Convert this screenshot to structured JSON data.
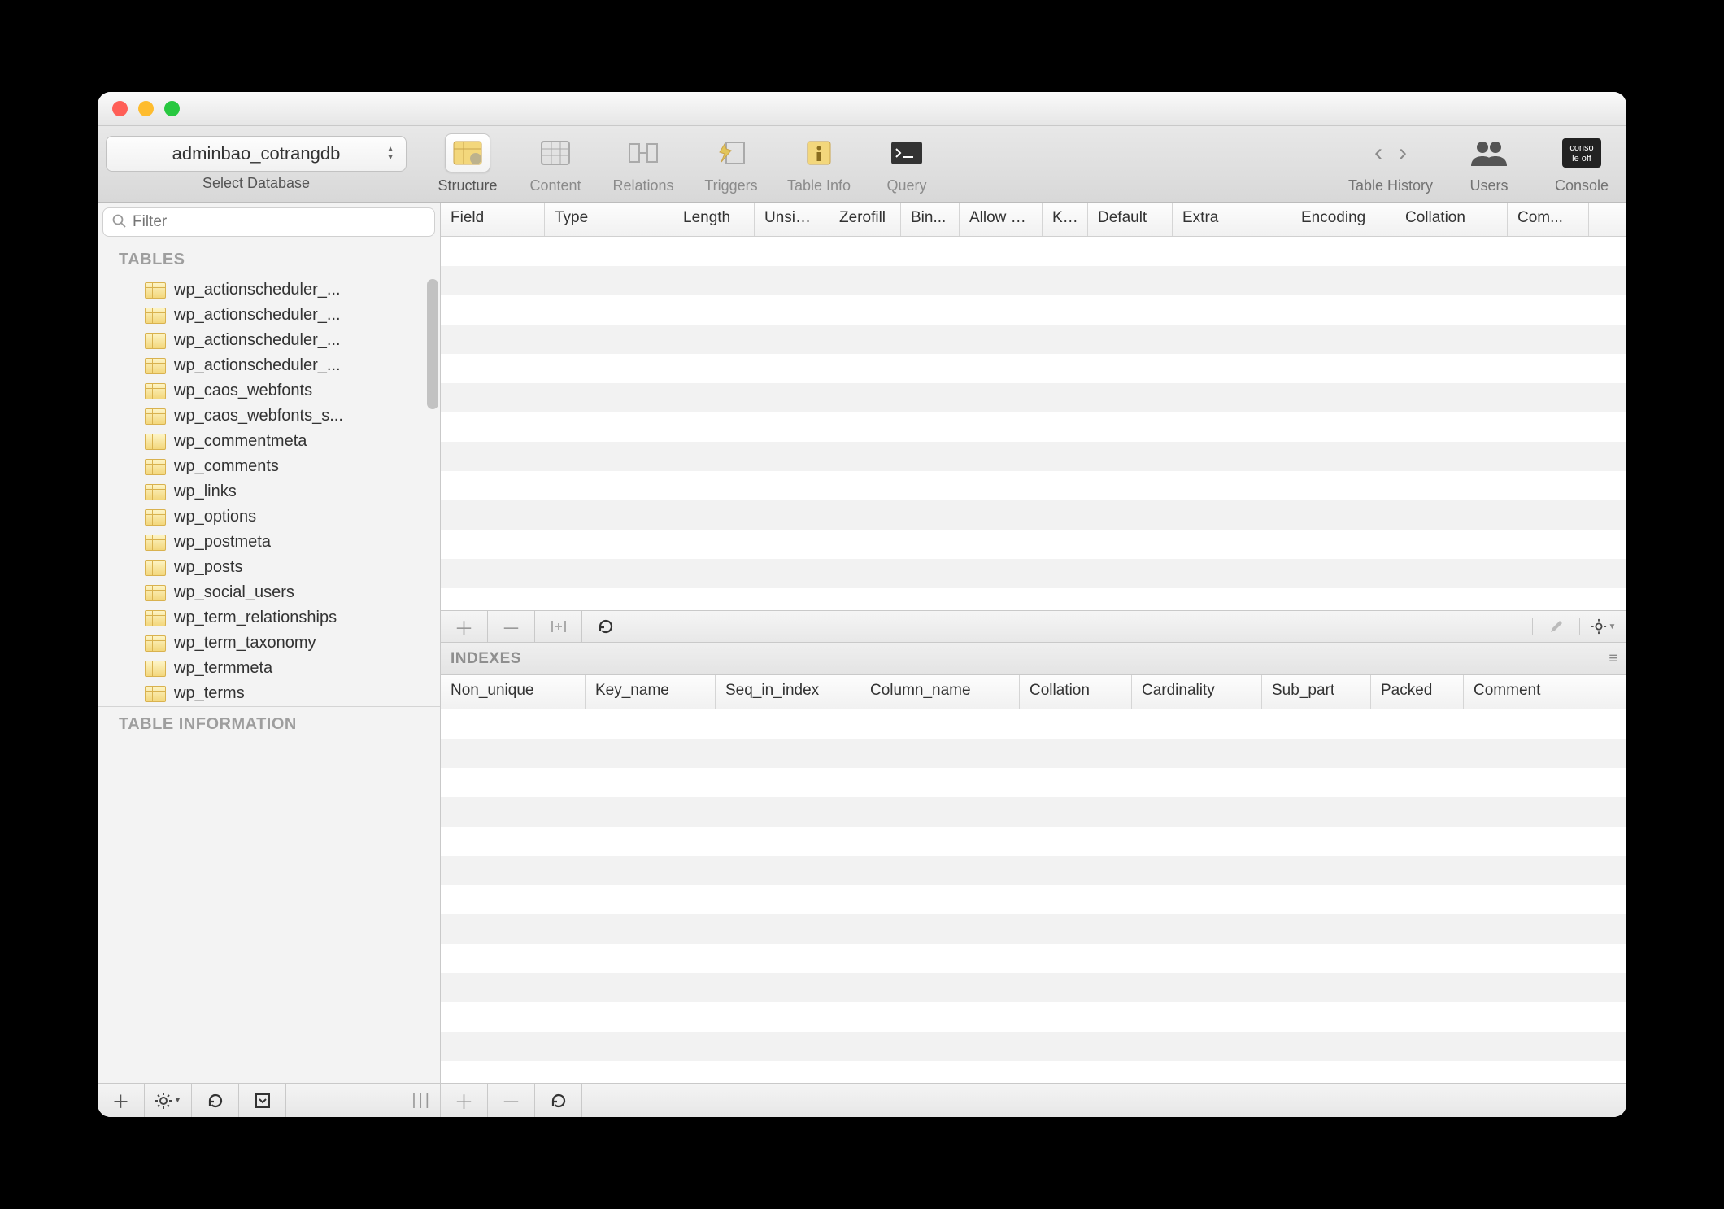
{
  "database": {
    "name": "adminbao_cotrangdb",
    "label": "Select Database"
  },
  "toolbar": {
    "buttons": [
      {
        "key": "structure",
        "label": "Structure",
        "active": true
      },
      {
        "key": "content",
        "label": "Content"
      },
      {
        "key": "relations",
        "label": "Relations"
      },
      {
        "key": "triggers",
        "label": "Triggers"
      },
      {
        "key": "tableinfo",
        "label": "Table Info"
      },
      {
        "key": "query",
        "label": "Query"
      }
    ],
    "history_label": "Table History",
    "users_label": "Users",
    "console_label": "Console"
  },
  "sidebar": {
    "filter_placeholder": "Filter",
    "tables_header": "TABLES",
    "info_header": "TABLE INFORMATION",
    "tables_visible": [
      "wp_actionscheduler_...",
      "wp_actionscheduler_...",
      "wp_actionscheduler_...",
      "wp_actionscheduler_...",
      "wp_caos_webfonts",
      "wp_caos_webfonts_s...",
      "wp_commentmeta",
      "wp_comments",
      "wp_links",
      "wp_options",
      "wp_postmeta",
      "wp_posts",
      "wp_social_users",
      "wp_term_relationships",
      "wp_term_taxonomy",
      "wp_termmeta",
      "wp_terms"
    ]
  },
  "structure_columns": [
    "Field",
    "Type",
    "Length",
    "Unsigned",
    "Zerofill",
    "Bin...",
    "Allow Null",
    "Key",
    "Default",
    "Extra",
    "Encoding",
    "Collation",
    "Com..."
  ],
  "structure_col_widths": [
    128,
    158,
    100,
    92,
    88,
    72,
    102,
    56,
    104,
    146,
    128,
    138,
    100
  ],
  "indexes_header": "INDEXES",
  "index_columns": [
    "Non_unique",
    "Key_name",
    "Seq_in_index",
    "Column_name",
    "Collation",
    "Cardinality",
    "Sub_part",
    "Packed",
    "Comment"
  ],
  "index_col_widths": [
    178,
    160,
    178,
    196,
    138,
    160,
    134,
    114,
    200
  ]
}
